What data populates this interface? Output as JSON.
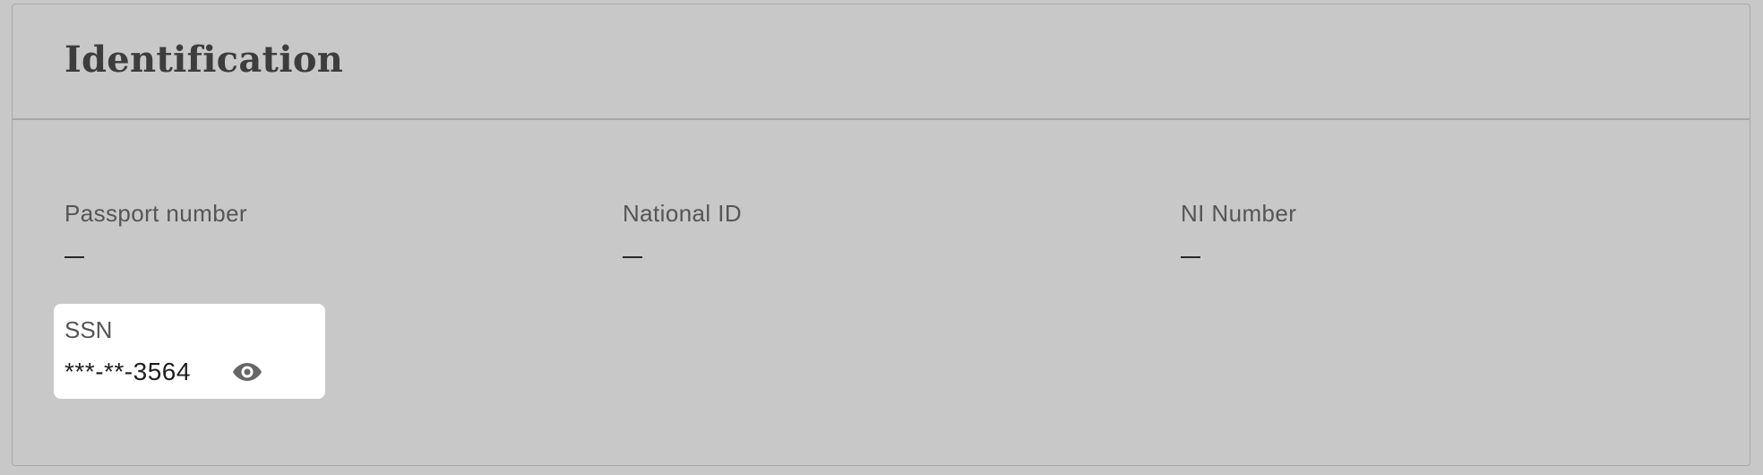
{
  "section": {
    "title": "Identification"
  },
  "fields": {
    "passport": {
      "label": "Passport number",
      "value": "—"
    },
    "national_id": {
      "label": "National ID",
      "value": "—"
    },
    "ni_number": {
      "label": "NI Number",
      "value": "—"
    }
  },
  "ssn": {
    "label": "SSN",
    "value": "***-**-3564",
    "reveal_icon": "eye-icon"
  },
  "colors": {
    "background": "#c8c8c8",
    "ssn_highlight": "#ffffff",
    "title": "#3d3d3d",
    "label": "#555555"
  }
}
